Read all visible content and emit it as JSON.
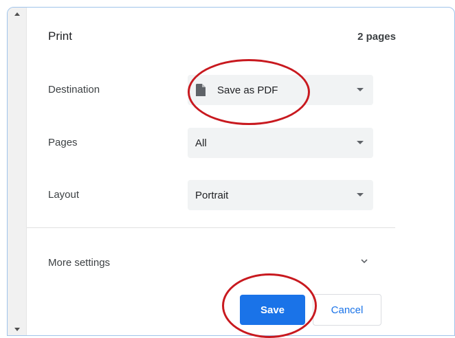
{
  "dialog": {
    "title": "Print",
    "page_count": "2 pages"
  },
  "settings": {
    "destination": {
      "label": "Destination",
      "value": "Save as PDF",
      "icon": "document-icon"
    },
    "pages": {
      "label": "Pages",
      "value": "All"
    },
    "layout": {
      "label": "Layout",
      "value": "Portrait"
    },
    "more_settings": "More settings"
  },
  "buttons": {
    "save": "Save",
    "cancel": "Cancel"
  },
  "colors": {
    "accent": "#1a73e8",
    "annotation": "#c8191f",
    "select_bg": "#f1f3f4"
  }
}
